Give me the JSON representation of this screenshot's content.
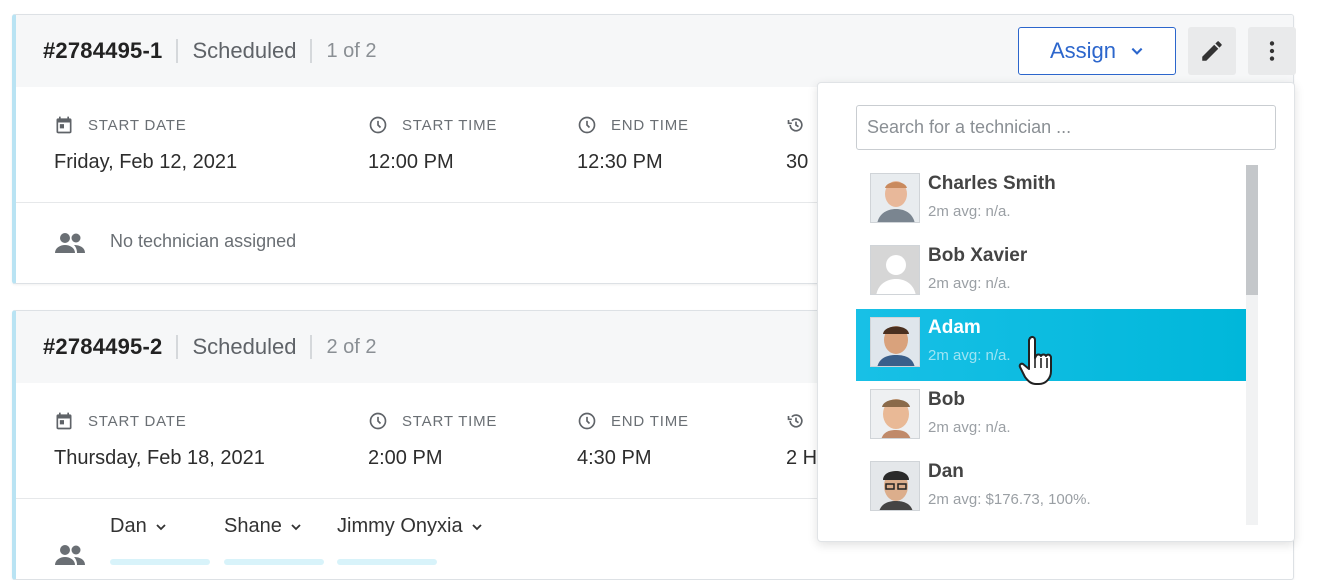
{
  "orders": [
    {
      "id": "#2784495-1",
      "status": "Scheduled",
      "count": "1 of 2",
      "start_date_label": "START DATE",
      "start_date": "Friday, Feb 12, 2021",
      "start_time_label": "START TIME",
      "start_time": "12:00 PM",
      "end_time_label": "END TIME",
      "end_time": "12:30 PM",
      "duration": "30",
      "no_tech": "No technician assigned"
    },
    {
      "id": "#2784495-2",
      "status": "Scheduled",
      "count": "2 of 2",
      "start_date_label": "START DATE",
      "start_date": "Thursday, Feb 18, 2021",
      "start_time_label": "START TIME",
      "start_time": "2:00 PM",
      "end_time_label": "END TIME",
      "end_time": "4:30 PM",
      "duration": "2 H",
      "techs": [
        "Dan",
        "Shane",
        "Jimmy Onyxia"
      ]
    }
  ],
  "toolbar": {
    "assign_label": "Assign",
    "icons": [
      "chevron-down-icon",
      "pencil-icon",
      "more-vertical-icon"
    ]
  },
  "dropdown": {
    "search_placeholder": "Search for a technician ...",
    "technicians": [
      {
        "name": "Charles Smith",
        "stat": "2m avg: n/a."
      },
      {
        "name": "Bob Xavier",
        "stat": "2m avg: n/a."
      },
      {
        "name": "Adam",
        "stat": "2m avg: n/a.",
        "active": true
      },
      {
        "name": "Bob",
        "stat": "2m avg: n/a."
      },
      {
        "name": "Dan",
        "stat": "2m avg: $176.73, 100%."
      }
    ]
  },
  "colors": {
    "accent": "#2c66cc",
    "highlight": "#00b7da",
    "card_border": "#b9e3f3"
  }
}
